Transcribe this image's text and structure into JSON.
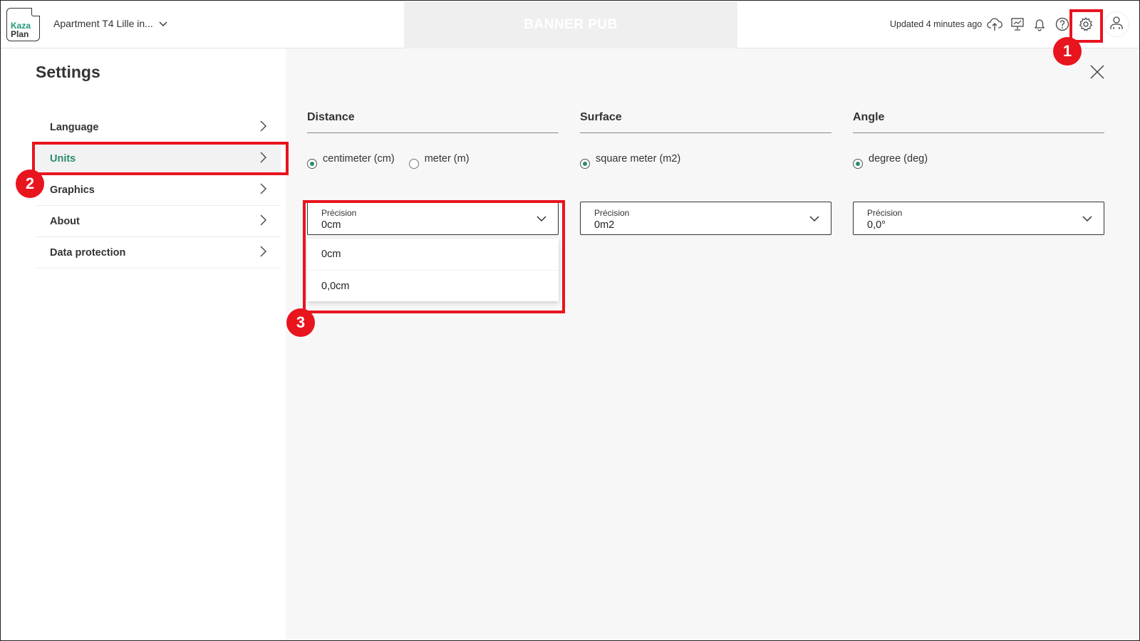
{
  "app": {
    "logo_line1": "Kaza",
    "logo_line2": "Plan",
    "project_name": "Apartment T4 Lille in...",
    "banner": "BANNER PUB",
    "updated": "Updated 4 minutes ago"
  },
  "icons": {
    "upload": "cloud-upload-icon",
    "presentation": "monitor-icon",
    "notifications": "bell-icon",
    "help": "help-circle-icon",
    "settings": "gear-icon",
    "user": "user-icon"
  },
  "settings": {
    "title": "Settings",
    "nav": [
      {
        "label": "Language"
      },
      {
        "label": "Units",
        "active": true
      },
      {
        "label": "Graphics"
      },
      {
        "label": "About"
      },
      {
        "label": "Data protection"
      }
    ]
  },
  "units": {
    "distance": {
      "title": "Distance",
      "options": [
        {
          "label": "centimeter (cm)",
          "selected": true
        },
        {
          "label": "meter (m)",
          "selected": false
        }
      ],
      "precision_label": "Précision",
      "precision_value": "0cm",
      "dropdown_options": [
        "0cm",
        "0,0cm"
      ]
    },
    "surface": {
      "title": "Surface",
      "options": [
        {
          "label": "square meter (m2)",
          "selected": true
        }
      ],
      "precision_label": "Précision",
      "precision_value": "0m2"
    },
    "angle": {
      "title": "Angle",
      "options": [
        {
          "label": "degree (deg)",
          "selected": true
        }
      ],
      "precision_label": "Précision",
      "precision_value": "0,0°"
    }
  },
  "annotations": {
    "badge1": "1",
    "badge2": "2",
    "badge3": "3"
  },
  "colors": {
    "accent": "#2a8c72",
    "highlight": "#e8141e",
    "panel_bg": "#f7f7f7"
  }
}
